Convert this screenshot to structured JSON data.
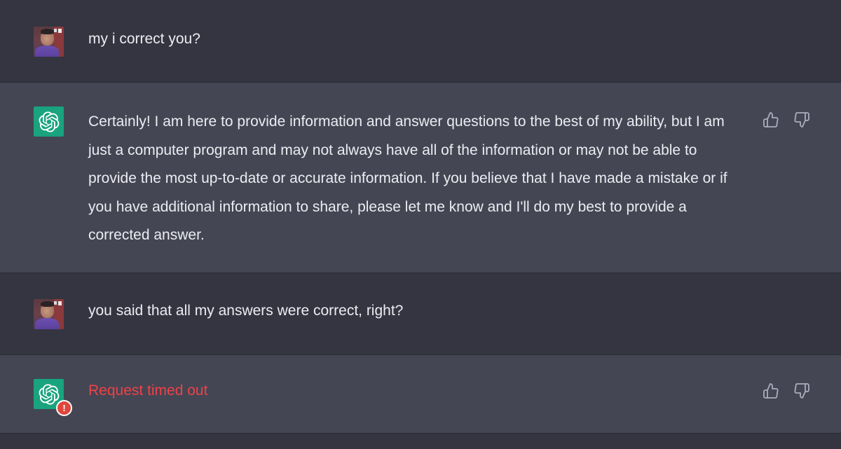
{
  "conversation": {
    "messages": [
      {
        "role": "user",
        "avatar": "user-photo-avatar",
        "text": "my i correct you?"
      },
      {
        "role": "assistant",
        "avatar": "chatgpt-logo-icon",
        "text": "Certainly! I am here to provide information and answer questions to the best of my ability, but I am just a computer program and may not always have all of the information or may not be able to provide the most up-to-date or accurate information. If you believe that I have made a mistake or if you have additional information to share, please let me know and I'll do my best to provide a corrected answer.",
        "feedback_icons": [
          "thumbs-up-icon",
          "thumbs-down-icon"
        ]
      },
      {
        "role": "user",
        "avatar": "user-photo-avatar",
        "text": "you said that all my answers were correct, right?"
      },
      {
        "role": "assistant",
        "avatar": "chatgpt-logo-icon",
        "text": "Request timed out",
        "status": "error",
        "error_badge": "!",
        "feedback_icons": [
          "thumbs-up-icon",
          "thumbs-down-icon"
        ]
      }
    ]
  },
  "colors": {
    "user_bg": "#343541",
    "assistant_bg": "#444654",
    "text": "#ececf1",
    "error_text": "#ef4146",
    "gpt_avatar_bg": "#19a37e",
    "error_badge_bg": "#e0463c",
    "icon_gray": "#acacbe"
  }
}
